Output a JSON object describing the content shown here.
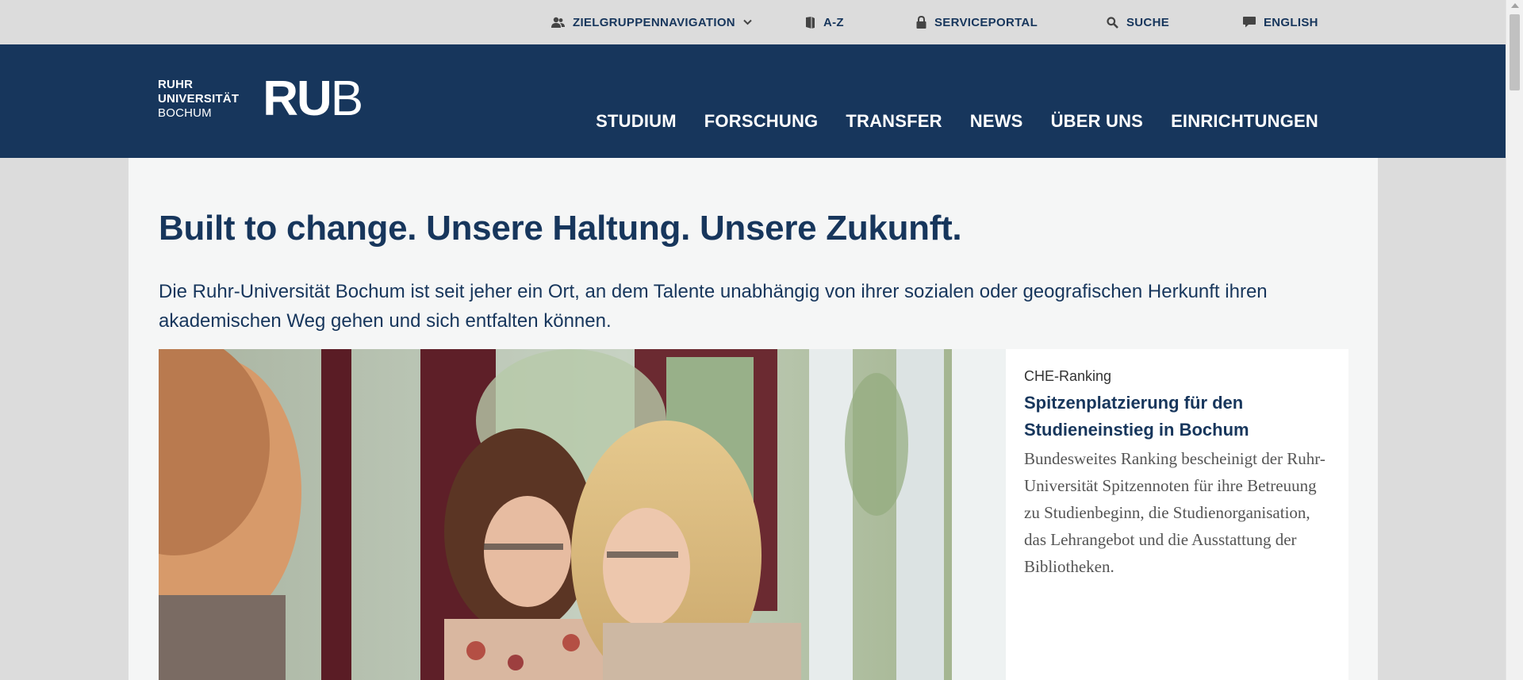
{
  "utility": {
    "audience_nav": "ZIELGRUPPENNAVIGATION",
    "az": "A-Z",
    "serviceportal": "SERVICEPORTAL",
    "search": "SUCHE",
    "language": "ENGLISH"
  },
  "logo": {
    "line1": "RUHR",
    "line2": "UNIVERSITÄT",
    "line3": "BOCHUM",
    "mark_bold": "RU",
    "mark_thin": "B"
  },
  "main_nav": [
    "STUDIUM",
    "FORSCHUNG",
    "TRANSFER",
    "NEWS",
    "ÜBER UNS",
    "EINRICHTUNGEN"
  ],
  "page": {
    "headline": "Built to change. Unsere Haltung. Unsere Zukunft.",
    "lead": "Die Ruhr-Universität Bochum ist seit jeher ein Ort, an dem Talente unabhängig von ihrer sozialen oder geografischen Herkunft ihren akademischen Weg gehen und sich entfalten können."
  },
  "teaser": {
    "kicker": "CHE-Ranking",
    "title": "Spitzenplatzierung für den Studieneinstieg in Bochum",
    "body": "Bundesweites Ranking bescheinigt der Ruhr-Universität Spitzennoten für ihre Betreuung zu Studienbeginn, die Studienorganisation, das Lehrangebot und die Ausstattung der Bibliotheken."
  },
  "colors": {
    "brand_blue": "#17365c",
    "utility_bg": "#dcdcdc",
    "content_bg": "#f5f6f6"
  },
  "icons": [
    "users-icon",
    "chevron-down-icon",
    "book-icon",
    "lock-icon",
    "search-icon",
    "speech-bubble-icon"
  ]
}
